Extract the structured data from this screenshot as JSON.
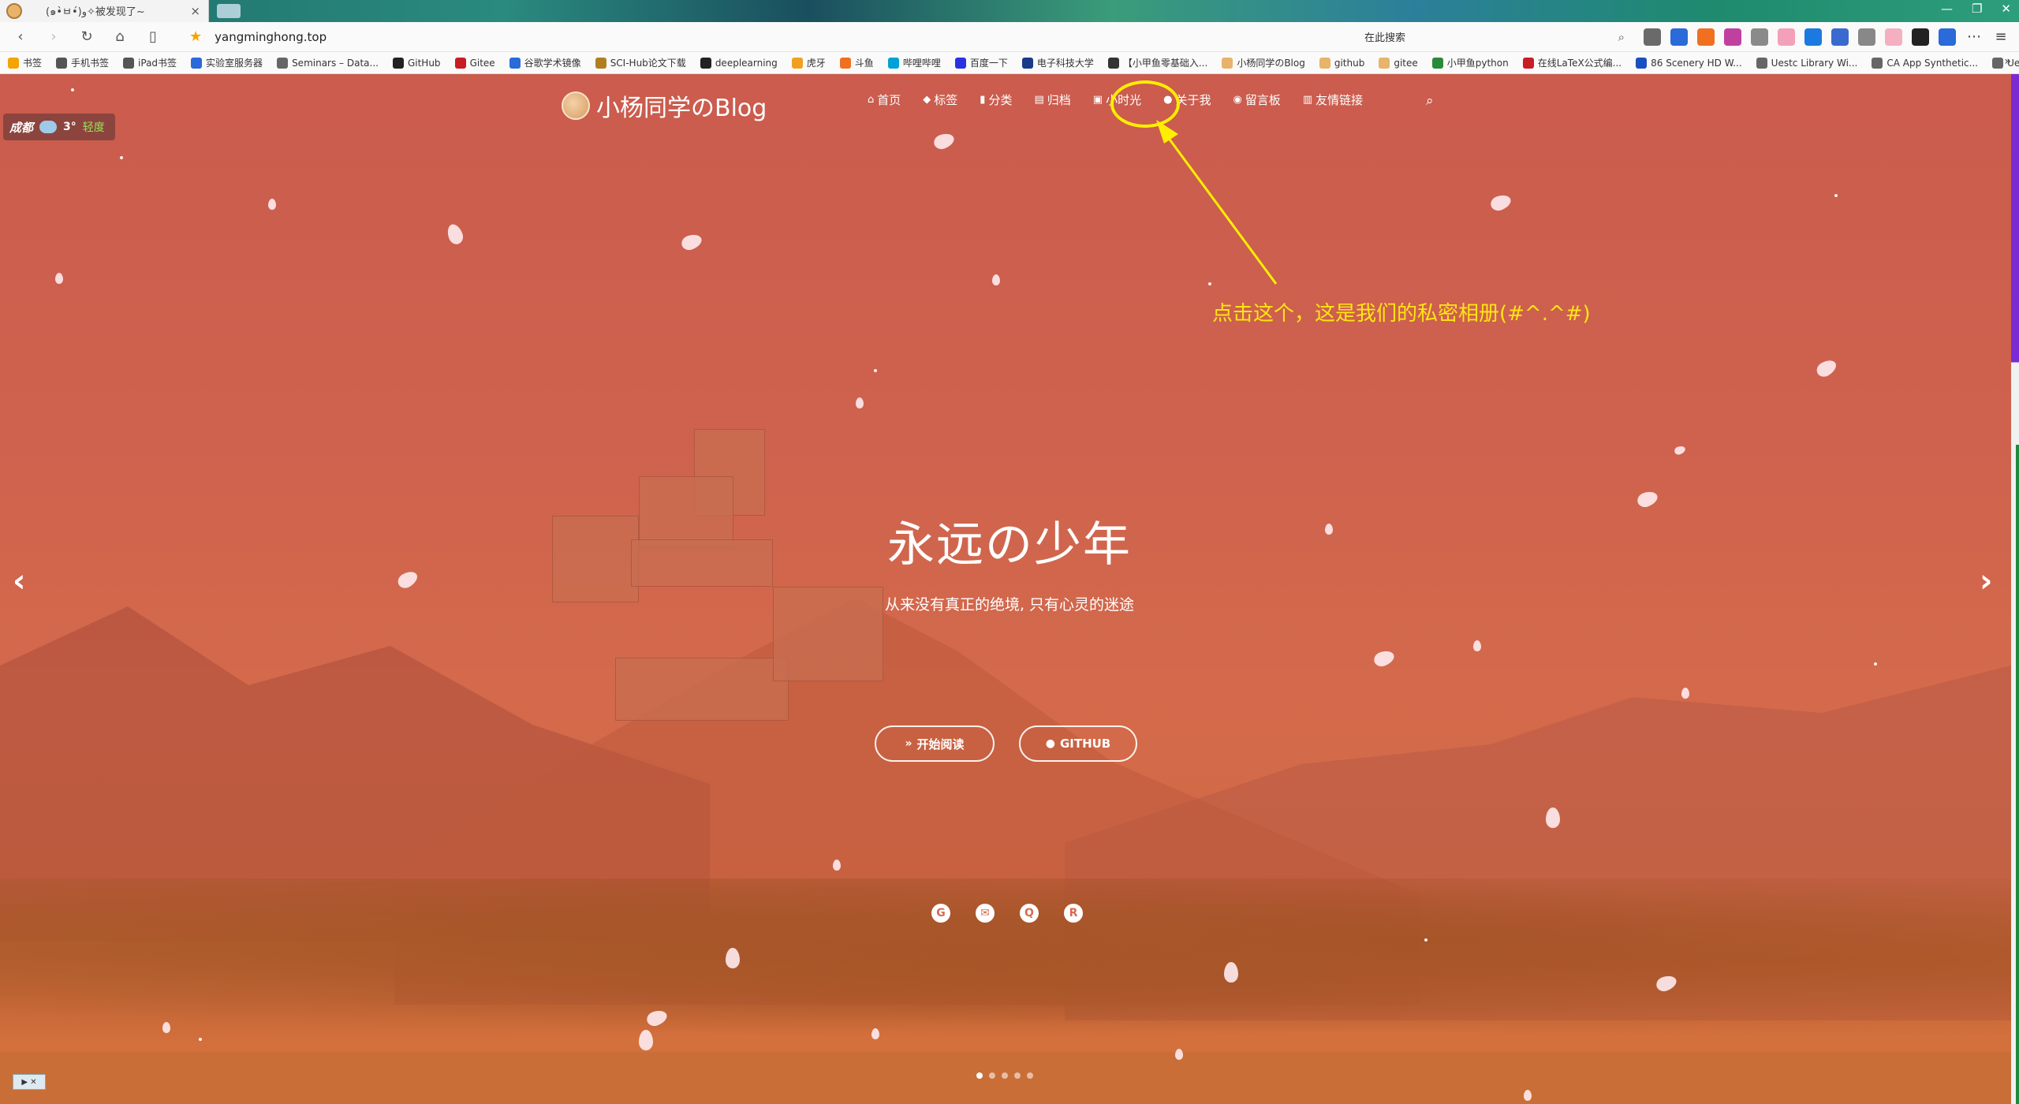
{
  "browser": {
    "tab_title": "(๑•̀ㅂ•́)و✧被发现了~",
    "url": "yangminghong.top",
    "search_engine_label": "在此搜索",
    "search_placeholder": ""
  },
  "bookmarks": [
    {
      "label": "书签",
      "icon": "star-icon",
      "color": "#f4a300"
    },
    {
      "label": "手机书签",
      "icon": "phone-icon",
      "color": "#555"
    },
    {
      "label": "iPad书签",
      "icon": "tablet-icon",
      "color": "#555"
    },
    {
      "label": "实验室服务器",
      "icon": "server-icon",
      "color": "#2a6ad9"
    },
    {
      "label": "Seminars – Data...",
      "icon": "globe-icon",
      "color": "#666"
    },
    {
      "label": "GitHub",
      "icon": "github-icon",
      "color": "#222"
    },
    {
      "label": "Gitee",
      "icon": "gitee-icon",
      "color": "#c71d23"
    },
    {
      "label": "谷歌学术镜像",
      "icon": "scholar-icon",
      "color": "#2a6ad9"
    },
    {
      "label": "SCI-Hub论文下载",
      "icon": "scihub-icon",
      "color": "#b08020"
    },
    {
      "label": "deeplearning",
      "icon": "github-icon",
      "color": "#222"
    },
    {
      "label": "虎牙",
      "icon": "huya-icon",
      "color": "#f0a020"
    },
    {
      "label": "斗鱼",
      "icon": "douyu-icon",
      "color": "#f07020"
    },
    {
      "label": "哔哩哔哩",
      "icon": "bilibili-icon",
      "color": "#00a1d6"
    },
    {
      "label": "百度一下",
      "icon": "baidu-icon",
      "color": "#2932e1"
    },
    {
      "label": "电子科技大学",
      "icon": "uestc-icon",
      "color": "#1a3a8a"
    },
    {
      "label": "【小甲鱼零基础入...",
      "icon": "fish-icon",
      "color": "#333"
    },
    {
      "label": "小杨同学のBlog",
      "icon": "blog-icon",
      "color": "#e8b36a"
    },
    {
      "label": "github",
      "icon": "blog-icon",
      "color": "#e8b36a"
    },
    {
      "label": "gitee",
      "icon": "blog-icon",
      "color": "#e8b36a"
    },
    {
      "label": "小甲鱼python",
      "icon": "fish-icon",
      "color": "#2a8a3a"
    },
    {
      "label": "在线LaTeX公式编...",
      "icon": "latex-icon",
      "color": "#c71d23"
    },
    {
      "label": "86 Scenery HD W...",
      "icon": "wallpaper-icon",
      "color": "#1a4fc0"
    },
    {
      "label": "Uestc Library Wi...",
      "icon": "globe-icon",
      "color": "#666"
    },
    {
      "label": "CA App Synthetic...",
      "icon": "globe-icon",
      "color": "#666"
    },
    {
      "label": "Uestc Library Wi...",
      "icon": "globe-icon",
      "color": "#666"
    }
  ],
  "site": {
    "title": "小杨同学のBlog",
    "nav": [
      {
        "label": "首页",
        "icon": "home-icon",
        "glyph": "⌂"
      },
      {
        "label": "标签",
        "icon": "tags-icon",
        "glyph": "◆"
      },
      {
        "label": "分类",
        "icon": "bookmark-icon",
        "glyph": "▮"
      },
      {
        "label": "归档",
        "icon": "archive-icon",
        "glyph": "▤"
      },
      {
        "label": "小时光",
        "icon": "image-icon",
        "glyph": "▣"
      },
      {
        "label": "关于我",
        "icon": "user-icon",
        "glyph": "●"
      },
      {
        "label": "留言板",
        "icon": "comments-icon",
        "glyph": "◉"
      },
      {
        "label": "友情链接",
        "icon": "link-icon",
        "glyph": "▥"
      }
    ],
    "weather": {
      "city": "成都",
      "temp": "3°",
      "air_quality": "轻度"
    }
  },
  "hero": {
    "title": "永远の少年",
    "subtitle": "从来没有真正的绝境, 只有心灵的迷途",
    "read_button": "开始阅读",
    "github_button": "GITHUB",
    "carousel_dots": 5,
    "carousel_active": 0
  },
  "annotation": {
    "text": "点击这个，这是我们的私密相册(#^.^#)",
    "color": "#ffe512"
  },
  "colors": {
    "overlay": "#d65f50",
    "annotation": "#ffee00",
    "weather_aq": "#9be05a"
  }
}
